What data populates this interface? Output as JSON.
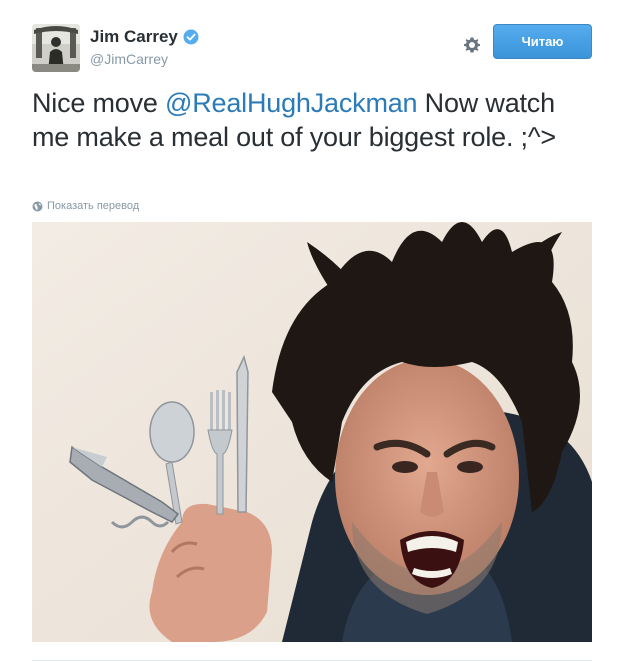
{
  "author": {
    "name": "Jim Carrey",
    "handle": "@JimCarrey",
    "verified": true
  },
  "actions": {
    "follow_label": "Читаю",
    "follow_color": "#55acee"
  },
  "icons": {
    "verified": "verified-badge-icon",
    "settings": "gear-icon",
    "translate": "globe-icon"
  },
  "tweet": {
    "text_before": "Nice move ",
    "mention": "@RealHughJackman",
    "text_after": " Now watch me make a meal out of your biggest role. ;^>",
    "translate_label": "Показать перевод",
    "mention_color": "#2b7bb9"
  }
}
